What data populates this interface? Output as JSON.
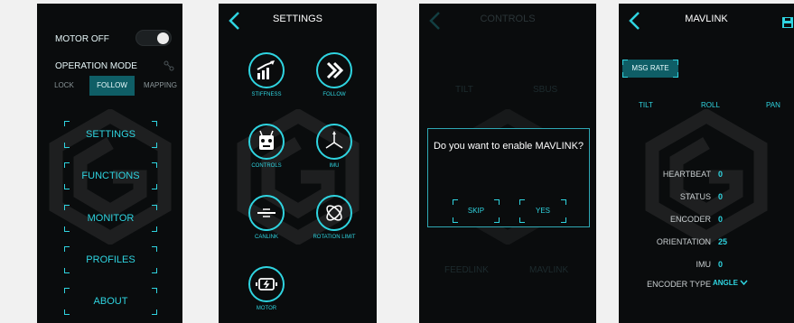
{
  "screen1": {
    "motor_label": "MOTOR OFF",
    "operation_mode_label": "OPERATION MODE",
    "modes": [
      "LOCK",
      "FOLLOW",
      "MAPPING"
    ],
    "menu": [
      "SETTINGS",
      "FUNCTIONS",
      "MONITOR",
      "PROFILES",
      "ABOUT"
    ]
  },
  "screen2": {
    "title": "SETTINGS",
    "tiles": [
      "STIFFNESS",
      "FOLLOW",
      "CONTROLS",
      "IMU",
      "CANLINK",
      "ROTATION LIMIT",
      "MOTOR"
    ]
  },
  "screen3": {
    "title": "CONTROLS",
    "faded_labels": [
      "TILT",
      "SBUS",
      "FEEDLINK",
      "MAVLINK"
    ],
    "dialog_text": "Do you want to enable MAVLINK?",
    "skip_label": "SKIP",
    "yes_label": "YES"
  },
  "screen4": {
    "title": "MAVLINK",
    "msg_rate_label": "MSG RATE",
    "axes": [
      "TILT",
      "ROLL",
      "PAN"
    ],
    "stats": [
      {
        "label": "HEARTBEAT",
        "value": "0"
      },
      {
        "label": "STATUS",
        "value": "0"
      },
      {
        "label": "ENCODER",
        "value": "0"
      },
      {
        "label": "ORIENTATION",
        "value": "25"
      },
      {
        "label": "IMU",
        "value": "0"
      }
    ],
    "encoder_type_label": "ENCODER TYPE",
    "encoder_type_value": "ANGLE"
  },
  "colors": {
    "accent": "#2fd4e0",
    "selected": "#0f5e66",
    "background": "#0a0c0d"
  }
}
